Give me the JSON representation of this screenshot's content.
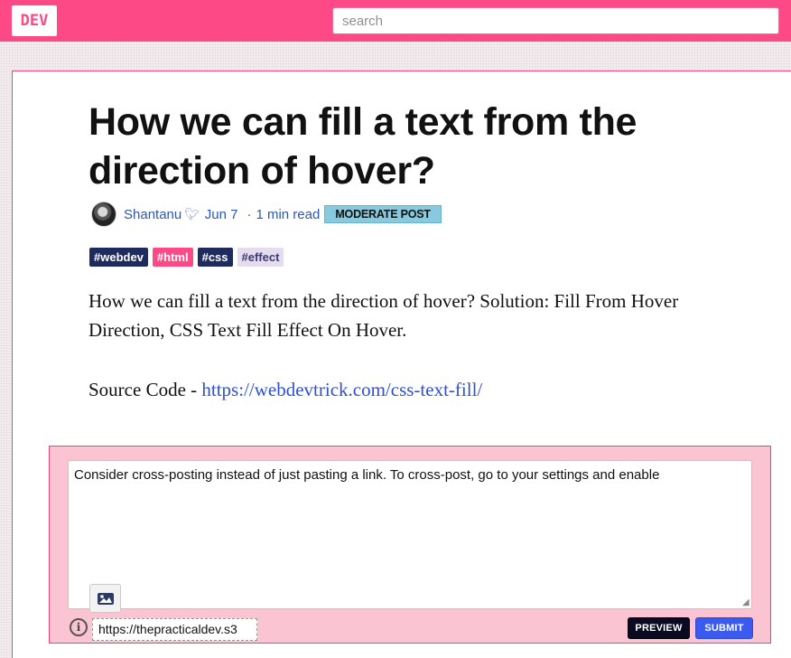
{
  "header": {
    "logo_text": "DEV",
    "search_placeholder": "search"
  },
  "article": {
    "title": "How we can fill a text from the direction of hover?",
    "author": "Shantanu",
    "date": "Jun 7",
    "read_time": "1 min read",
    "moderation_badge": "MODERATE POST",
    "tags": [
      {
        "label": "#webdev",
        "bg": "#1e2b5e",
        "color": "#ffffff"
      },
      {
        "label": "#html",
        "bg": "#fd4a87",
        "color": "#ffffff"
      },
      {
        "label": "#css",
        "bg": "#1e2b5e",
        "color": "#ffffff"
      },
      {
        "label": "#effect",
        "bg": "#e6dcef",
        "color": "#3b3b6b"
      }
    ],
    "body": "How we can fill a text from the direction of hover? Solution: Fill From Hover Direction, CSS Text Fill Effect On Hover.",
    "source_label": "Source Code - ",
    "source_link": "https://webdevtrick.com/css-text-fill/"
  },
  "comment": {
    "text": "Consider cross-posting instead of just pasting a link. To cross-post, go to your settings and enable",
    "url_value": "https://thepracticaldev.s3",
    "preview_label": "PREVIEW",
    "submit_label": "SUBMIT",
    "info_symbol": "i"
  },
  "colors": {
    "brand_pink": "#fd4a87",
    "submit_blue": "#3b5bf0",
    "badge_blue": "#87c9de",
    "comment_bg": "#fbc4d3"
  },
  "icons": {
    "image_upload": "image-upload-icon",
    "info": "info-icon",
    "author_flair": "bird-icon"
  }
}
